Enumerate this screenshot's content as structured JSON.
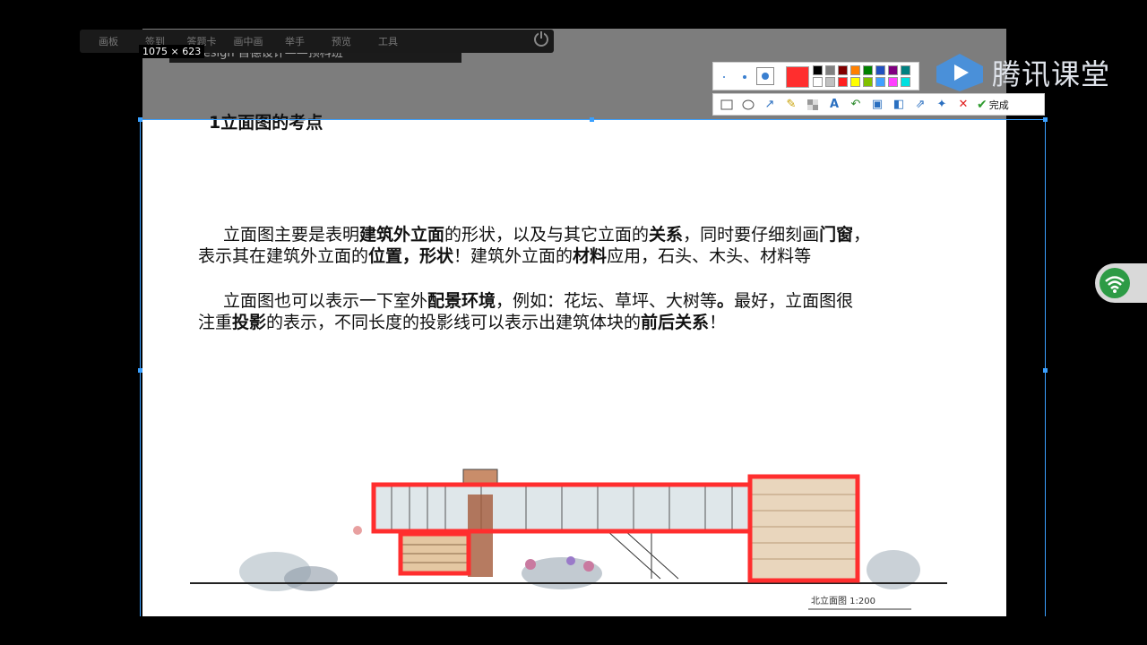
{
  "toolbar": {
    "items": [
      "画板",
      "签到",
      "答题卡",
      "画中画",
      "举手",
      "预览",
      "工具"
    ]
  },
  "class_title": "er design  自德设计——预科班",
  "capture_size": "1075 × 623",
  "slide": {
    "heading": "1立面图的考点",
    "p1_a": "立面图主要是表明",
    "p1_b": "建筑外立面",
    "p1_c": "的形状，以及与其它立面的",
    "p1_d": "关系",
    "p1_e": "，同时要仔细刻画",
    "p1_f": "门窗",
    "p1_g": "，",
    "p1_h": "表示其在建筑外立面的",
    "p1_i": "位置，形状",
    "p1_j": "！建筑外立面的",
    "p1_k": "材料",
    "p1_l": "应用，石头、木头、材料等",
    "p2_a": "立面图也可以表示一下室外",
    "p2_b": "配景环境",
    "p2_c": "，例如：花坛、草坪、大树等",
    "p2_d": "。",
    "p2_e": "最好，立面图很",
    "p2_f": "注重",
    "p2_g": "投影",
    "p2_h": "的表示，不同长度的投影线可以表示出建筑体块的",
    "p2_i": "前后关系",
    "p2_j": "！",
    "sketch_caption": "北立面图 1:200"
  },
  "annotation": {
    "done_label": "完成",
    "current_color": "#ff2e2e",
    "swatches_row1": [
      "#000000",
      "#808080",
      "#800000",
      "#ff8000",
      "#008000",
      "#2050c0",
      "#800080",
      "#008080"
    ],
    "swatches_row2": [
      "#ffffff",
      "#c0c0c0",
      "#ff2020",
      "#ffff00",
      "#80c000",
      "#40a0ff",
      "#ff40ff",
      "#00e0e0"
    ]
  },
  "logo": {
    "text": "腾讯课堂"
  },
  "colors": {
    "selection": "#3aa0ff",
    "annotation_red": "#ff2e2e",
    "logo_blue": "#4a90d9"
  }
}
